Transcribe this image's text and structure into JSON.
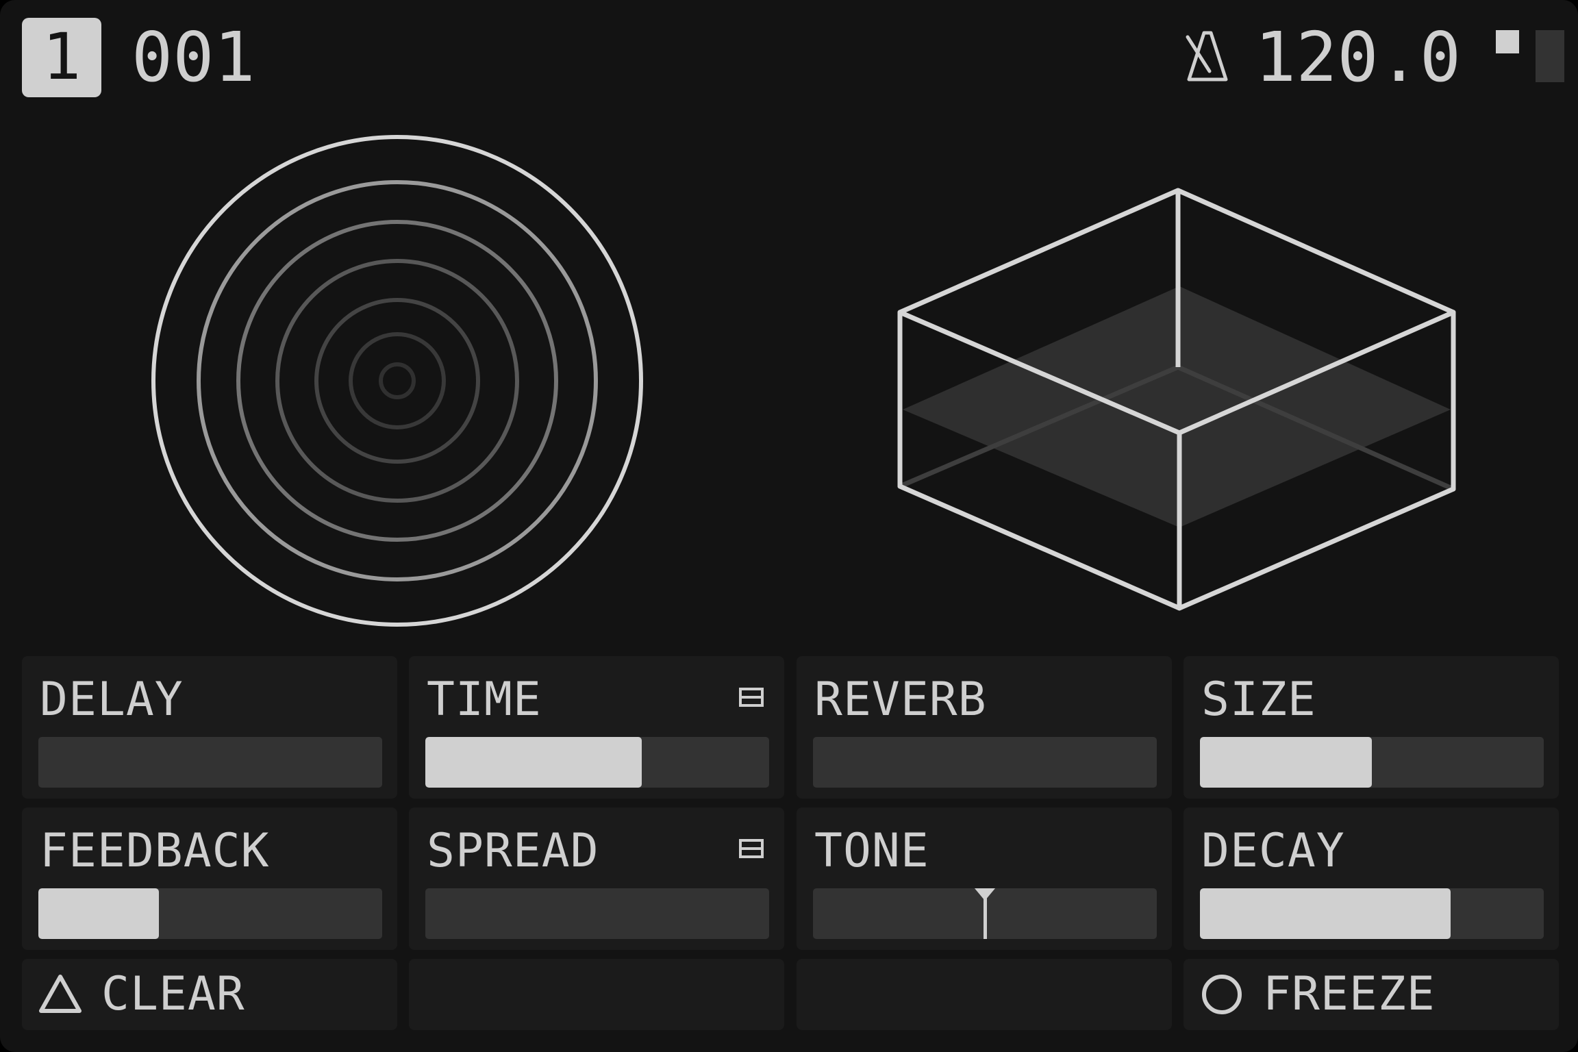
{
  "header": {
    "preset_number": "1",
    "preset_index": "001",
    "tempo_icon": "metronome-icon",
    "bpm": "120.0"
  },
  "params": [
    {
      "label": "DELAY",
      "value": 0.0
    },
    {
      "label": "TIME",
      "value": 0.63,
      "icon": "menu-icon"
    },
    {
      "label": "REVERB",
      "value": 0.0
    },
    {
      "label": "SIZE",
      "value": 0.5
    },
    {
      "label": "FEEDBACK",
      "value": 0.35
    },
    {
      "label": "SPREAD",
      "value": 0.0,
      "icon": "menu-icon"
    },
    {
      "label": "TONE",
      "value": 0.5,
      "style": "center-marker"
    },
    {
      "label": "DECAY",
      "value": 0.73
    }
  ],
  "actions": {
    "clear": {
      "label": "CLEAR",
      "icon": "triangle-icon"
    },
    "freeze": {
      "label": "FREEZE",
      "icon": "circle-icon"
    }
  },
  "colors": {
    "background": "#131313",
    "cell": "#1b1b1b",
    "track": "#333333",
    "fill": "#d0d0d0",
    "text": "#cfcfcf"
  }
}
